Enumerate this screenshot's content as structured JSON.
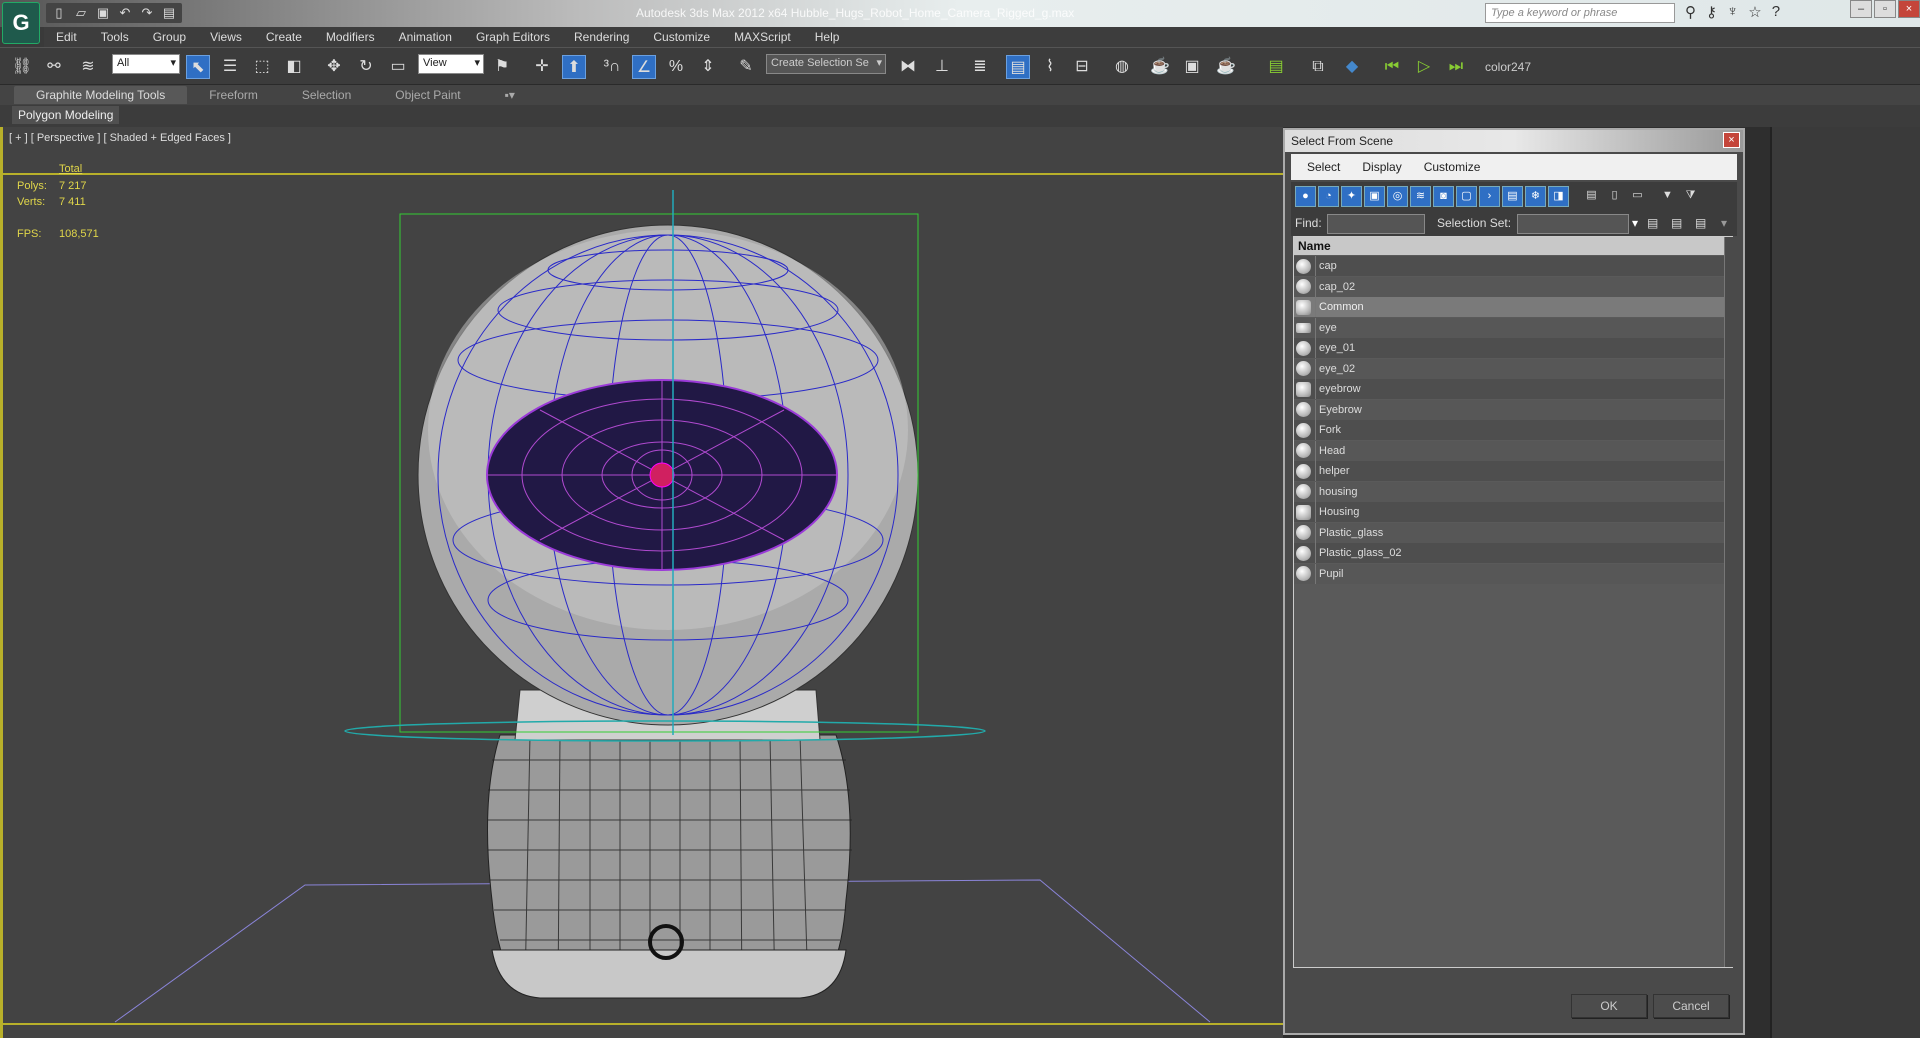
{
  "app": {
    "title": "Autodesk 3ds Max 2012 x64    Hubble_Hugs_Robot_Home_Camera_Rigged_g.max",
    "search_placeholder": "Type a keyword or phrase"
  },
  "menu": [
    "Edit",
    "Tools",
    "Group",
    "Views",
    "Create",
    "Modifiers",
    "Animation",
    "Graph Editors",
    "Rendering",
    "Customize",
    "MAXScript",
    "Help"
  ],
  "toolbar": {
    "selection_filter": "All",
    "ref_coord": "View",
    "named_sel": "Create Selection Se",
    "color_label": "color247"
  },
  "ribbon": {
    "tabs": [
      "Graphite Modeling Tools",
      "Freeform",
      "Selection",
      "Object Paint"
    ],
    "panel": "Polygon Modeling"
  },
  "viewport": {
    "label": "[ + ] [ Perspective ] [ Shaded + Edged Faces ]",
    "stats": {
      "header": "Total",
      "polys_label": "Polys:",
      "polys": "7 217",
      "verts_label": "Verts:",
      "verts": "7 411",
      "fps_label": "FPS:",
      "fps": "108,571"
    }
  },
  "dialog": {
    "title": "Select From Scene",
    "menu": [
      "Select",
      "Display",
      "Customize"
    ],
    "find_label": "Find:",
    "find_value": "",
    "selset_label": "Selection Set:",
    "column": "Name",
    "items": [
      {
        "name": "cap",
        "type": "geometry"
      },
      {
        "name": "cap_02",
        "type": "geometry"
      },
      {
        "name": "Common",
        "type": "group",
        "selected": true
      },
      {
        "name": "eye",
        "type": "camera"
      },
      {
        "name": "eye_01",
        "type": "geometry"
      },
      {
        "name": "eye_02",
        "type": "geometry"
      },
      {
        "name": "eyebrow",
        "type": "group"
      },
      {
        "name": "Eyebrow",
        "type": "geometry"
      },
      {
        "name": "Fork",
        "type": "geometry"
      },
      {
        "name": "Head",
        "type": "geometry"
      },
      {
        "name": "helper",
        "type": "geometry"
      },
      {
        "name": "housing",
        "type": "geometry"
      },
      {
        "name": "Housing",
        "type": "group"
      },
      {
        "name": "Plastic_glass",
        "type": "geometry"
      },
      {
        "name": "Plastic_glass_02",
        "type": "geometry"
      },
      {
        "name": "Pupil",
        "type": "geometry"
      }
    ],
    "ok": "OK",
    "cancel": "Cancel"
  }
}
